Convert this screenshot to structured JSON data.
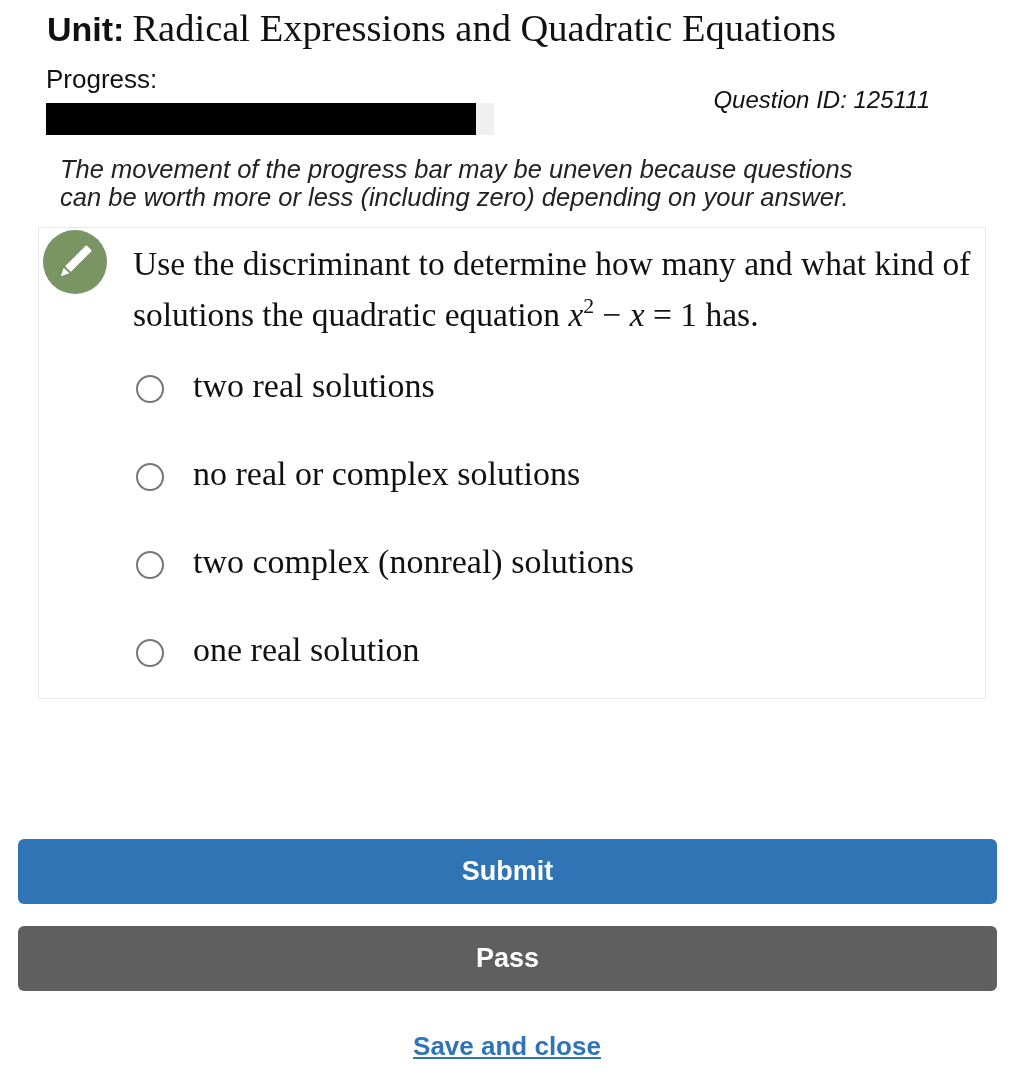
{
  "unit": {
    "label": "Unit:",
    "title": "Radical Expressions and Quadratic Equations"
  },
  "progress": {
    "label": "Progress:",
    "level": 0.96
  },
  "question_id": "Question ID: 125111",
  "note": "The movement of the progress bar may be uneven because questions can be worth more or less (including zero) depending on your answer.",
  "question": {
    "text": "Use the discriminant to determine how many and what kind of solutions the quadratic equation *x*$^{2}$ − *x* = 1 has.",
    "options": [
      {
        "label": "two real solutions",
        "selected": false
      },
      {
        "label": "no real or complex solutions",
        "selected": false
      },
      {
        "label": "two complex (nonreal) solutions",
        "selected": false
      },
      {
        "label": "one real solution",
        "selected": false
      }
    ]
  },
  "buttons": [
    {
      "label": "Submit",
      "kind": "primary"
    },
    {
      "label": "Pass",
      "kind": "secondary"
    }
  ],
  "link": "Save and close"
}
